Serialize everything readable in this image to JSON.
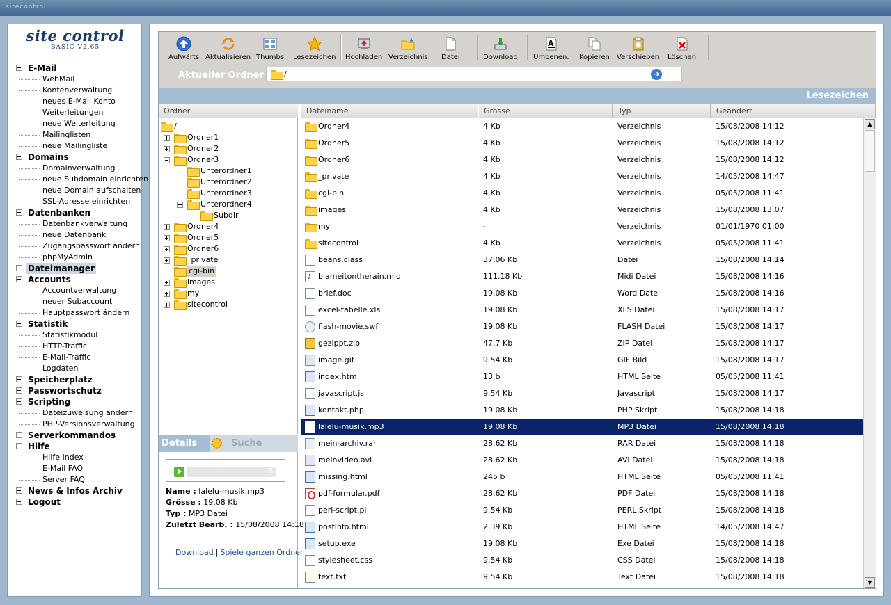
{
  "app": {
    "brand": "sitecontrol"
  },
  "logo": {
    "title": "site control",
    "version": "BASIC V2.65"
  },
  "menu": [
    {
      "label": "E-Mail",
      "expanded": true,
      "items": [
        "WebMail",
        "Kontenverwaltung",
        "neues E-Mail Konto",
        "Weiterleitungen",
        "neue Weiterleitung",
        "Mailinglisten",
        "neue Mailingliste"
      ]
    },
    {
      "label": "Domains",
      "expanded": true,
      "items": [
        "Domainverwaltung",
        "neue Subdomain einrichten",
        "neue Domain aufschalten",
        "SSL-Adresse einrichten"
      ]
    },
    {
      "label": "Datenbanken",
      "expanded": true,
      "items": [
        "Datenbankverwaltung",
        "neue Datenbank",
        "Zugangspasswort ändern",
        "phpMyAdmin"
      ]
    },
    {
      "label": "Dateimanager",
      "expanded": false,
      "selected": true,
      "items": []
    },
    {
      "label": "Accounts",
      "expanded": true,
      "items": [
        "Accountverwaltung",
        "neuer Subaccount",
        "Hauptpasswort ändern"
      ]
    },
    {
      "label": "Statistik",
      "expanded": true,
      "items": [
        "Statistikmodul",
        "HTTP-Traffic",
        "E-Mail-Traffic",
        "Logdaten"
      ]
    },
    {
      "label": "Speicherplatz",
      "expanded": false,
      "items": []
    },
    {
      "label": "Passwortschutz",
      "expanded": false,
      "items": []
    },
    {
      "label": "Scripting",
      "expanded": true,
      "items": [
        "Dateizuweisung ändern",
        "PHP-Versionsverwaltung"
      ]
    },
    {
      "label": "Serverkommandos",
      "expanded": false,
      "items": []
    },
    {
      "label": "Hilfe",
      "expanded": true,
      "items": [
        "Hilfe Index",
        "E-Mail FAQ",
        "Server FAQ"
      ]
    },
    {
      "label": "News & Infos Archiv",
      "expanded": false,
      "items": []
    },
    {
      "label": "Logout",
      "expanded": false,
      "items": []
    }
  ],
  "toolbar": [
    {
      "label": "Aufwärts",
      "icon": "arrow-up-icon"
    },
    {
      "label": "Aktualisieren",
      "icon": "refresh-icon"
    },
    {
      "label": "Thumbs",
      "icon": "thumbs-icon"
    },
    {
      "label": "Lesezeichen",
      "icon": "star-icon"
    },
    {
      "label": "Hochladen",
      "icon": "upload-icon"
    },
    {
      "label": "Verzeichnis",
      "icon": "new-folder-icon"
    },
    {
      "label": "Datei",
      "icon": "new-file-icon"
    },
    {
      "label": "Download",
      "icon": "download-icon"
    },
    {
      "label": "Umbenen.",
      "icon": "rename-icon"
    },
    {
      "label": "Kopieren",
      "icon": "copy-icon"
    },
    {
      "label": "Verschieben",
      "icon": "move-icon"
    },
    {
      "label": "Löschen",
      "icon": "delete-icon"
    }
  ],
  "address": {
    "label": "Aktueller Ordner",
    "value": "/"
  },
  "bookmarks_bar": {
    "title": "Lesezeichen"
  },
  "tree": {
    "header": "Ordner",
    "nodes": [
      {
        "label": "/",
        "level": 0,
        "toggle": "none"
      },
      {
        "label": "Ordner1",
        "level": 1,
        "toggle": "plus"
      },
      {
        "label": "Ordner2",
        "level": 1,
        "toggle": "plus"
      },
      {
        "label": "Ordner3",
        "level": 1,
        "toggle": "minus"
      },
      {
        "label": "Unterordner1",
        "level": 2,
        "toggle": "none"
      },
      {
        "label": "Unterordner2",
        "level": 2,
        "toggle": "none"
      },
      {
        "label": "Unterordner3",
        "level": 2,
        "toggle": "none"
      },
      {
        "label": "Unterordner4",
        "level": 2,
        "toggle": "minus"
      },
      {
        "label": "Subdir",
        "level": 3,
        "toggle": "none"
      },
      {
        "label": "Ordner4",
        "level": 1,
        "toggle": "plus"
      },
      {
        "label": "Ordner5",
        "level": 1,
        "toggle": "plus"
      },
      {
        "label": "Ordner6",
        "level": 1,
        "toggle": "plus"
      },
      {
        "label": "_private",
        "level": 1,
        "toggle": "plus"
      },
      {
        "label": "cgi-bin",
        "level": 1,
        "toggle": "none",
        "selected": true
      },
      {
        "label": "images",
        "level": 1,
        "toggle": "plus"
      },
      {
        "label": "my",
        "level": 1,
        "toggle": "plus"
      },
      {
        "label": "sitecontrol",
        "level": 1,
        "toggle": "plus"
      }
    ]
  },
  "details_tabs": {
    "details": "Details",
    "search": "Suche"
  },
  "details": {
    "name_label": "Name :",
    "name": "lalelu-musik.mp3",
    "size_label": "Grösse :",
    "size": "19.08 Kb",
    "type_label": "Typ :",
    "type": "MP3 Datei",
    "modified_label": "Zuletzt Bearb. :",
    "modified": "15/08/2008 14:18",
    "player_help": "?",
    "link_download": "Download",
    "link_play": "Spiele ganzen Ordner",
    "link_sep": "|"
  },
  "file_columns": [
    "Dateiname",
    "Grösse",
    "Typ",
    "Geändert"
  ],
  "files": [
    {
      "name": "Ordner4",
      "size": "4 Kb",
      "type": "Verzeichnis",
      "date": "15/08/2008 14:12",
      "icon": "folder"
    },
    {
      "name": "Ordner5",
      "size": "4 Kb",
      "type": "Verzeichnis",
      "date": "15/08/2008 14:12",
      "icon": "folder"
    },
    {
      "name": "Ordner6",
      "size": "4 Kb",
      "type": "Verzeichnis",
      "date": "15/08/2008 14:12",
      "icon": "folder"
    },
    {
      "name": "_private",
      "size": "4 Kb",
      "type": "Verzeichnis",
      "date": "14/05/2008 14:47",
      "icon": "folder"
    },
    {
      "name": "cgi-bin",
      "size": "4 Kb",
      "type": "Verzeichnis",
      "date": "05/05/2008 11:41",
      "icon": "folder"
    },
    {
      "name": "images",
      "size": "4 Kb",
      "type": "Verzeichnis",
      "date": "15/08/2008 13:07",
      "icon": "folder"
    },
    {
      "name": "my",
      "size": "-",
      "type": "Verzeichnis",
      "date": "01/01/1970 01:00",
      "icon": "folder"
    },
    {
      "name": "sitecontrol",
      "size": "4 Kb",
      "type": "Verzeichnis",
      "date": "05/05/2008 11:41",
      "icon": "folder"
    },
    {
      "name": "beans.class",
      "size": "37.06 Kb",
      "type": "Datei",
      "date": "15/08/2008 14:14",
      "icon": "file"
    },
    {
      "name": "blameitontherain.mid",
      "size": "111.18 Kb",
      "type": "Midi Datei",
      "date": "15/08/2008 14:16",
      "icon": "mid"
    },
    {
      "name": "brief.doc",
      "size": "19.08 Kb",
      "type": "Word Datei",
      "date": "15/08/2008 14:16",
      "icon": "file"
    },
    {
      "name": "excel-tabelle.xls",
      "size": "19.08 Kb",
      "type": "XLS Datei",
      "date": "15/08/2008 14:17",
      "icon": "file"
    },
    {
      "name": "flash-movie.swf",
      "size": "19.08 Kb",
      "type": "FLASH Datei",
      "date": "15/08/2008 14:17",
      "icon": "swf"
    },
    {
      "name": "gezippt.zip",
      "size": "47.7 Kb",
      "type": "ZIP Datei",
      "date": "15/08/2008 14:17",
      "icon": "zip"
    },
    {
      "name": "image.gif",
      "size": "9.54 Kb",
      "type": "GIF Bild",
      "date": "15/08/2008 14:17",
      "icon": "img"
    },
    {
      "name": "index.htm",
      "size": "13 b",
      "type": "HTML Seite",
      "date": "05/05/2008 11:41",
      "icon": "html"
    },
    {
      "name": "javascript.js",
      "size": "9.54 Kb",
      "type": "Javascript",
      "date": "15/08/2008 14:17",
      "icon": "file"
    },
    {
      "name": "kontakt.php",
      "size": "19.08 Kb",
      "type": "PHP Skript",
      "date": "15/08/2008 14:18",
      "icon": "html"
    },
    {
      "name": "lalelu-musik.mp3",
      "size": "19.08 Kb",
      "type": "MP3 Datei",
      "date": "15/08/2008 14:18",
      "icon": "mp3",
      "selected": true
    },
    {
      "name": "mein-archiv.rar",
      "size": "28.62 Kb",
      "type": "RAR Datei",
      "date": "15/08/2008 14:18",
      "icon": "rar"
    },
    {
      "name": "meinvideo.avi",
      "size": "28.62 Kb",
      "type": "AVI Datei",
      "date": "15/08/2008 14:18",
      "icon": "img"
    },
    {
      "name": "missing.html",
      "size": "245 b",
      "type": "HTML Seite",
      "date": "05/05/2008 11:41",
      "icon": "html"
    },
    {
      "name": "pdf-formular.pdf",
      "size": "28.62 Kb",
      "type": "PDF Datei",
      "date": "15/08/2008 14:18",
      "icon": "pdf"
    },
    {
      "name": "perl-script.pl",
      "size": "9.54 Kb",
      "type": "PERL Skript",
      "date": "15/08/2008 14:18",
      "icon": "file"
    },
    {
      "name": "postinfo.html",
      "size": "2.39 Kb",
      "type": "HTML Seite",
      "date": "14/05/2008 14:47",
      "icon": "html"
    },
    {
      "name": "setup.exe",
      "size": "19.08 Kb",
      "type": "Exe Datei",
      "date": "15/08/2008 14:18",
      "icon": "exe"
    },
    {
      "name": "stylesheet.css",
      "size": "9.54 Kb",
      "type": "CSS Datei",
      "date": "15/08/2008 14:18",
      "icon": "file"
    },
    {
      "name": "text.txt",
      "size": "9.54 Kb",
      "type": "Text Datei",
      "date": "15/08/2008 14:18",
      "icon": "txt"
    }
  ]
}
